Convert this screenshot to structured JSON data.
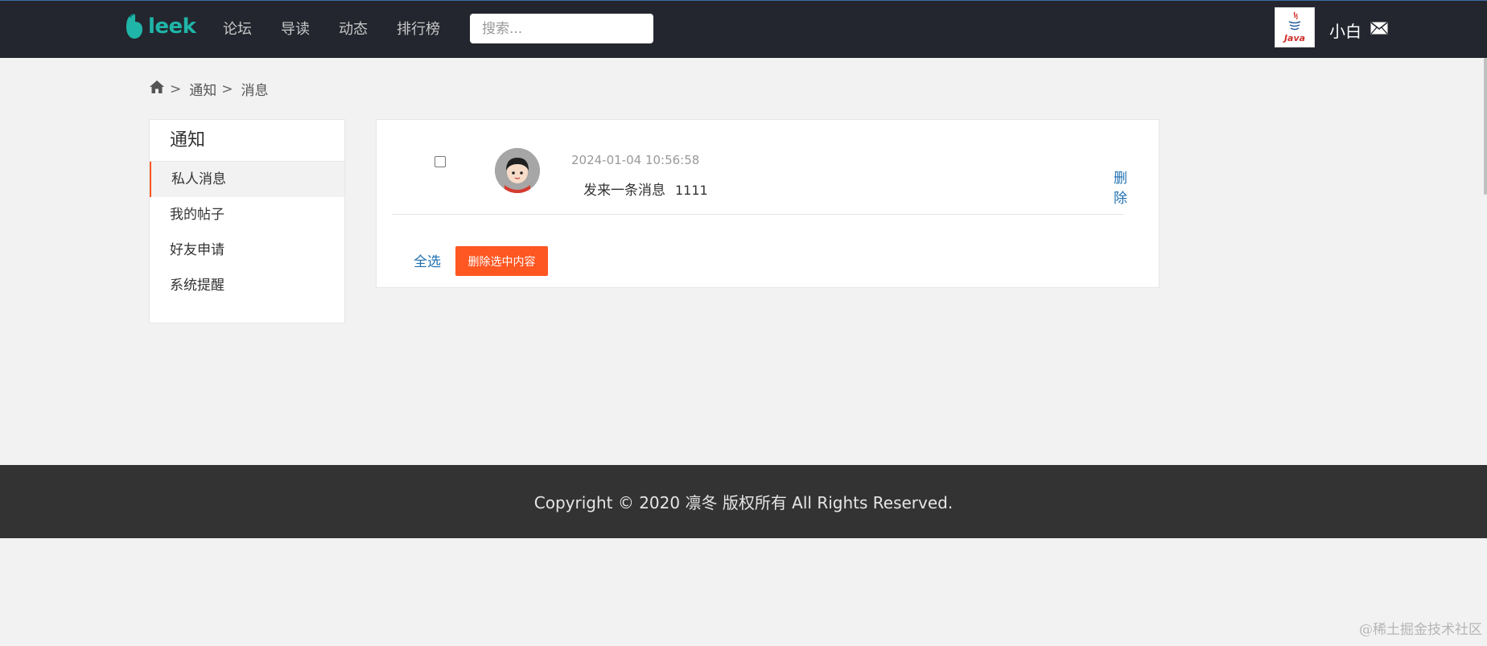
{
  "header": {
    "logo_text": "leek",
    "nav": [
      "论坛",
      "导读",
      "动态",
      "排行榜"
    ],
    "search_placeholder": "搜索...",
    "avatar_label": "Java",
    "username": "小白"
  },
  "breadcrumb": {
    "items": [
      "通知",
      "消息"
    ],
    "separator": ">"
  },
  "sidebar": {
    "title": "通知",
    "items": [
      {
        "label": "私人消息",
        "active": true
      },
      {
        "label": "我的帖子",
        "active": false
      },
      {
        "label": "好友申请",
        "active": false
      },
      {
        "label": "系统提醒",
        "active": false
      }
    ]
  },
  "messages": [
    {
      "time": "2024-01-04 10:56:58",
      "action": "发来一条消息",
      "content": "1111",
      "delete_label": "删除"
    }
  ],
  "actions": {
    "select_all": "全选",
    "delete_selected": "删除选中内容"
  },
  "footer": {
    "copyright": "Copyright  © 2020  凛冬 版权所有 All Rights Reserved."
  },
  "watermark": "@稀土掘金技术社区",
  "colors": {
    "header_bg": "#23262e",
    "accent": "#ff5722",
    "link": "#1e6fb0",
    "logo": "#1fb5a8"
  }
}
